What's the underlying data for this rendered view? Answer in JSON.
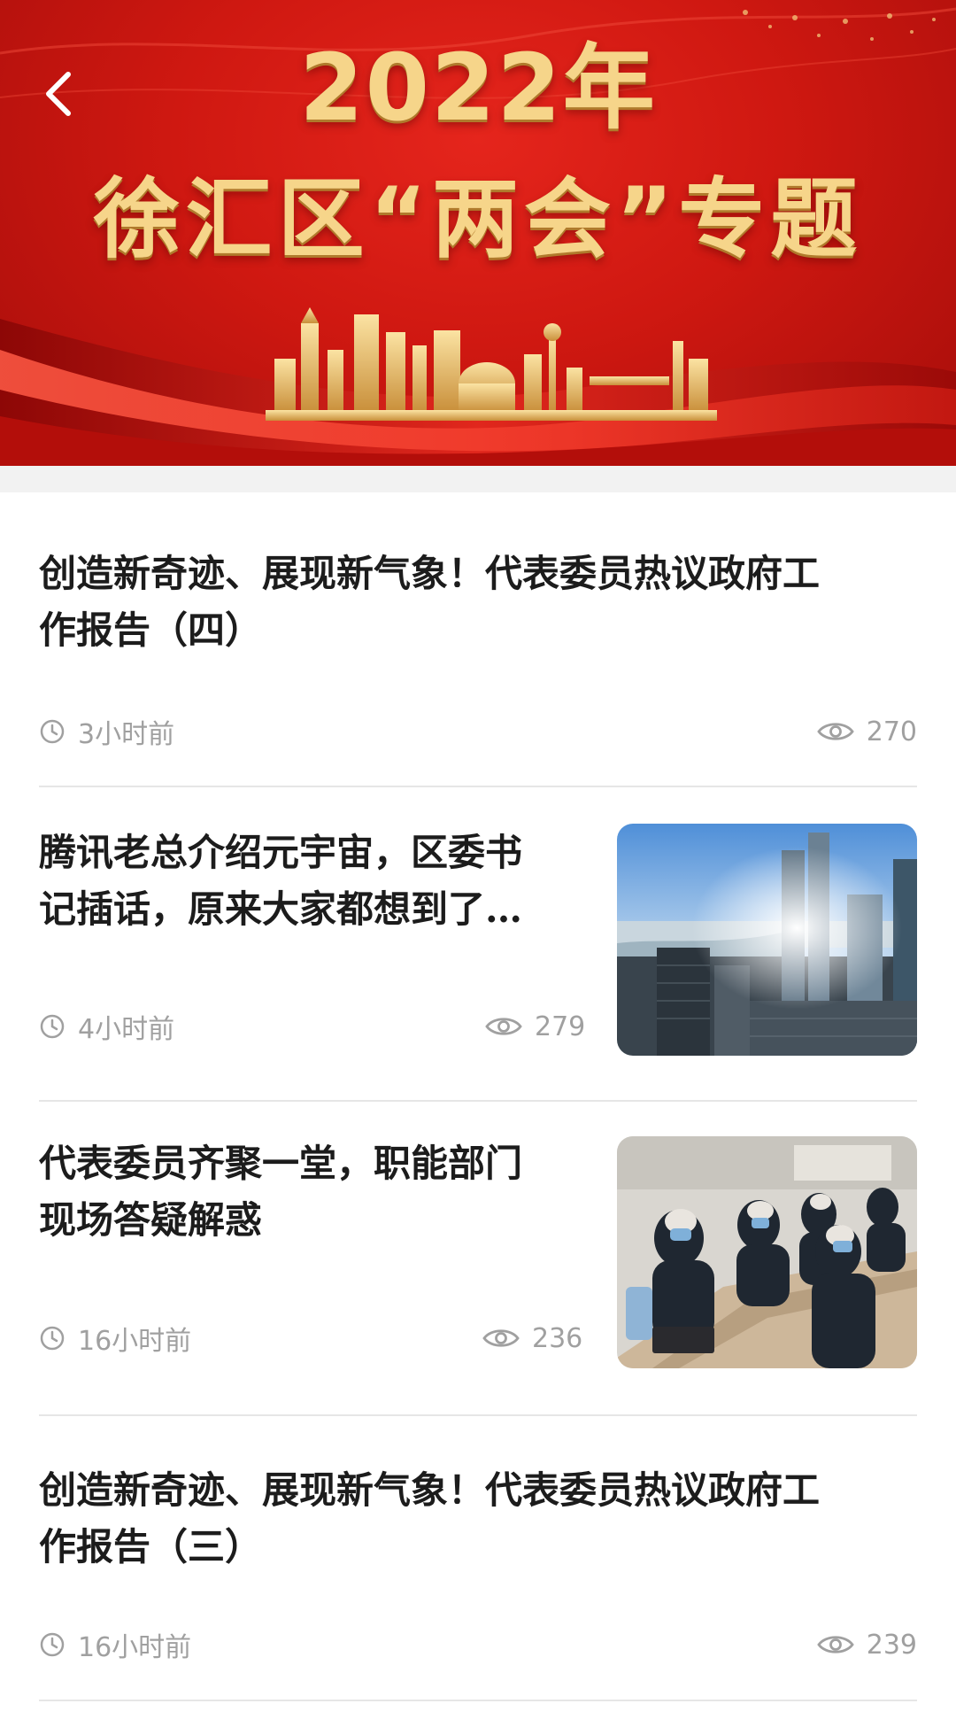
{
  "banner": {
    "year": "2022年",
    "title": "徐汇区“两会”专题",
    "colors": {
      "red": "#d41b13",
      "gold": "#f6d58a"
    }
  },
  "nav": {
    "back_icon": "chevron-left-icon"
  },
  "articles": [
    {
      "title_line1": "创造新奇迹、展现新气象！代表委员热议政府工",
      "title_line2": "作报告（四）",
      "time": "3小时前",
      "views": "270",
      "has_thumbnail": false
    },
    {
      "title_line1": "腾讯老总介绍元宇宙，区委书",
      "title_line2": "记插话，原来大家都想到了…",
      "time": "4小时前",
      "views": "279",
      "has_thumbnail": true,
      "thumbnail": "city-skyline-photo"
    },
    {
      "title_line1": "代表委员齐聚一堂，职能部门",
      "title_line2": "现场答疑解惑",
      "time": "16小时前",
      "views": "236",
      "has_thumbnail": true,
      "thumbnail": "meeting-photo"
    },
    {
      "title_line1": "创造新奇迹、展现新气象！代表委员热议政府工",
      "title_line2": "作报告（三）",
      "time": "16小时前",
      "views": "239",
      "has_thumbnail": false
    }
  ]
}
